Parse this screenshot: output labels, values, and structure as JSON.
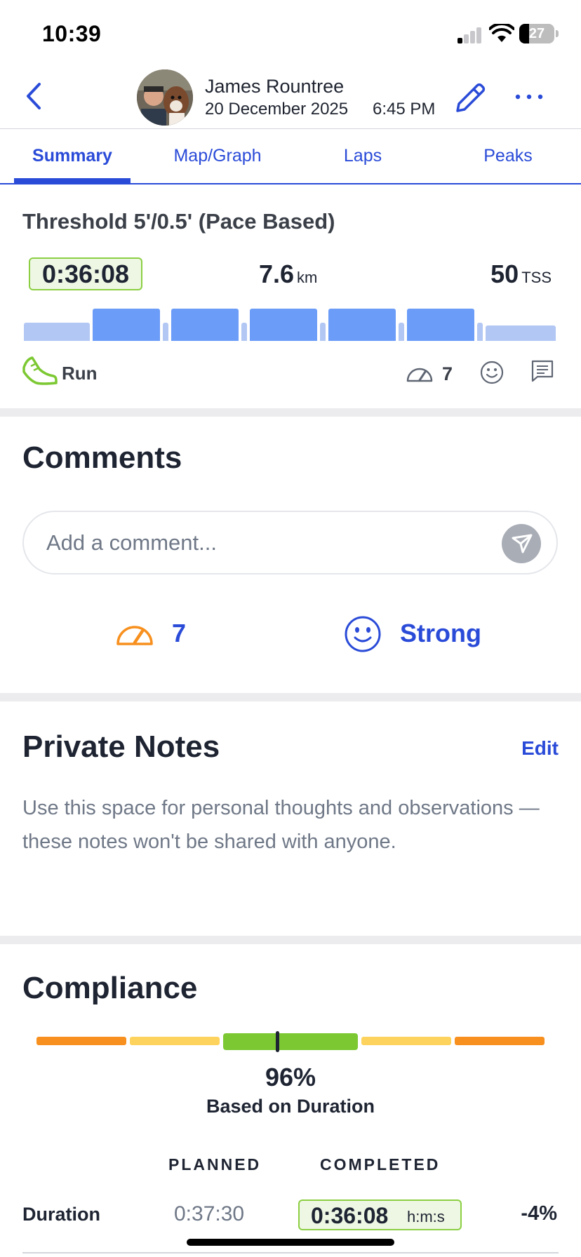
{
  "status_bar": {
    "time": "10:39",
    "battery": "27",
    "battery_level": 0.27
  },
  "header": {
    "athlete_name": "James Rountree",
    "date": "20 December 2025",
    "time": "6:45 PM"
  },
  "tabs": [
    {
      "label": "Summary",
      "active": true
    },
    {
      "label": "Map/Graph",
      "active": false
    },
    {
      "label": "Laps",
      "active": false
    },
    {
      "label": "Peaks",
      "active": false
    }
  ],
  "summary": {
    "workout_title": "Threshold 5'/0.5' (Pace Based)",
    "duration": "0:36:08",
    "distance_value": "7.6",
    "distance_unit": "km",
    "tss_value": "50",
    "tss_unit": "TSS",
    "sport": "Run",
    "rpe": "7",
    "icons": {
      "sport": "running-shoe-icon",
      "rpe": "speedometer-icon",
      "feel": "smiley-icon",
      "comment": "comment-icon"
    }
  },
  "comments": {
    "title": "Comments",
    "placeholder": "Add a comment...",
    "rpe": "7",
    "feel": "Strong"
  },
  "private_notes": {
    "title": "Private Notes",
    "edit_label": "Edit",
    "text": "Use this space for personal thoughts and observations — these notes won't be shared with anyone."
  },
  "compliance": {
    "title": "Compliance",
    "percent": "96%",
    "basis": "Based on Duration",
    "columns": {
      "planned": "PLANNED",
      "completed": "COMPLETED"
    },
    "rows": [
      {
        "label": "Duration",
        "planned": "0:37:30",
        "completed": "0:36:08",
        "unit": "h:m:s",
        "delta": "-4%"
      }
    ]
  },
  "colors": {
    "accent": "#2a4bd8",
    "compliance_orange": "#f7901e",
    "compliance_yellow": "#fdd35e",
    "compliance_green": "#7cc832",
    "interval_bar": "#6b9cf8",
    "easy_bar": "#b2c7f3"
  }
}
